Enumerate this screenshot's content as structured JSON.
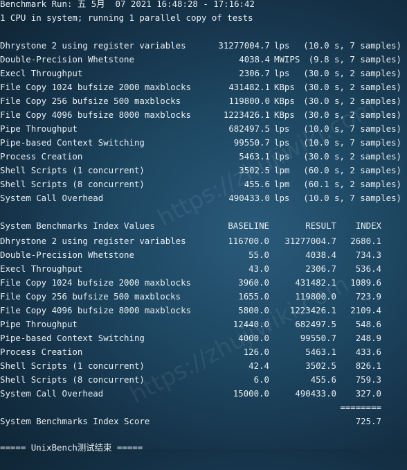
{
  "header": {
    "run_line": "Benchmark Run: 五 5月  07 2021 16:48:28 - 17:16:42",
    "cpu_line": "1 CPU in system; running 1 parallel copy of tests"
  },
  "results": [
    {
      "name": "Dhrystone 2 using register variables",
      "value": "31277004.7",
      "unit": "lps",
      "info": "(10.0 s, 7 samples)"
    },
    {
      "name": "Double-Precision Whetstone",
      "value": "4038.4",
      "unit": "MWIPS",
      "info": "(9.8 s, 7 samples)"
    },
    {
      "name": "Execl Throughput",
      "value": "2306.7",
      "unit": "lps",
      "info": "(30.0 s, 2 samples)"
    },
    {
      "name": "File Copy 1024 bufsize 2000 maxblocks",
      "value": "431482.1",
      "unit": "KBps",
      "info": "(30.0 s, 2 samples)"
    },
    {
      "name": "File Copy 256 bufsize 500 maxblocks",
      "value": "119800.0",
      "unit": "KBps",
      "info": "(30.0 s, 2 samples)"
    },
    {
      "name": "File Copy 4096 bufsize 8000 maxblocks",
      "value": "1223426.1",
      "unit": "KBps",
      "info": "(30.0 s, 2 samples)"
    },
    {
      "name": "Pipe Throughput",
      "value": "682497.5",
      "unit": "lps",
      "info": "(10.0 s, 7 samples)"
    },
    {
      "name": "Pipe-based Context Switching",
      "value": "99550.7",
      "unit": "lps",
      "info": "(10.0 s, 7 samples)"
    },
    {
      "name": "Process Creation",
      "value": "5463.1",
      "unit": "lps",
      "info": "(30.0 s, 2 samples)"
    },
    {
      "name": "Shell Scripts (1 concurrent)",
      "value": "3502.5",
      "unit": "lpm",
      "info": "(60.0 s, 2 samples)"
    },
    {
      "name": "Shell Scripts (8 concurrent)",
      "value": "455.6",
      "unit": "lpm",
      "info": "(60.1 s, 2 samples)"
    },
    {
      "name": "System Call Overhead",
      "value": "490433.0",
      "unit": "lps",
      "info": "(10.0 s, 7 samples)"
    }
  ],
  "index": {
    "title": "System Benchmarks Index Values",
    "col_baseline": "BASELINE",
    "col_result": "RESULT",
    "col_index": "INDEX",
    "rows": [
      {
        "name": "Dhrystone 2 using register variables",
        "baseline": "116700.0",
        "result": "31277004.7",
        "index": "2680.1"
      },
      {
        "name": "Double-Precision Whetstone",
        "baseline": "55.0",
        "result": "4038.4",
        "index": "734.3"
      },
      {
        "name": "Execl Throughput",
        "baseline": "43.0",
        "result": "2306.7",
        "index": "536.4"
      },
      {
        "name": "File Copy 1024 bufsize 2000 maxblocks",
        "baseline": "3960.0",
        "result": "431482.1",
        "index": "1089.6"
      },
      {
        "name": "File Copy 256 bufsize 500 maxblocks",
        "baseline": "1655.0",
        "result": "119800.0",
        "index": "723.9"
      },
      {
        "name": "File Copy 4096 bufsize 8000 maxblocks",
        "baseline": "5800.0",
        "result": "1223426.1",
        "index": "2109.4"
      },
      {
        "name": "Pipe Throughput",
        "baseline": "12440.0",
        "result": "682497.5",
        "index": "548.6"
      },
      {
        "name": "Pipe-based Context Switching",
        "baseline": "4000.0",
        "result": "99550.7",
        "index": "248.9"
      },
      {
        "name": "Process Creation",
        "baseline": "126.0",
        "result": "5463.1",
        "index": "433.6"
      },
      {
        "name": "Shell Scripts (1 concurrent)",
        "baseline": "42.4",
        "result": "3502.5",
        "index": "826.1"
      },
      {
        "name": "Shell Scripts (8 concurrent)",
        "baseline": "6.0",
        "result": "455.6",
        "index": "759.3"
      },
      {
        "name": "System Call Overhead",
        "baseline": "15000.0",
        "result": "490433.0",
        "index": "327.0"
      }
    ],
    "separator": "========",
    "score_label": "System Benchmarks Index Score",
    "score": "725.7"
  },
  "footer_line": "===== UnixBench测试结束 =====",
  "watermark": "https://zhujiwiki.com"
}
